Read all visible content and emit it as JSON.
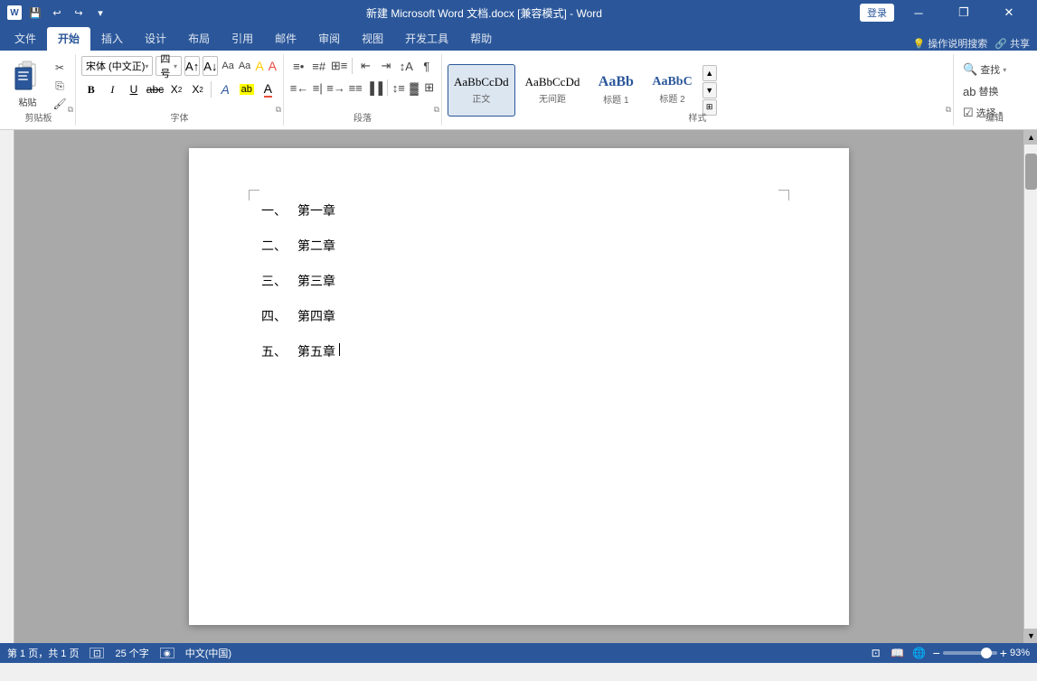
{
  "titlebar": {
    "title": "新建 Microsoft Word 文档.docx [兼容模式] - Word",
    "login_label": "登录",
    "window_buttons": [
      "—",
      "❐",
      "✕"
    ]
  },
  "ribbon_tabs": {
    "items": [
      "文件",
      "开始",
      "插入",
      "设计",
      "布局",
      "引用",
      "邮件",
      "审阅",
      "视图",
      "开发工具",
      "帮助"
    ],
    "active": "开始",
    "right_items": [
      "💡 操作说明搜索",
      "♪ 共享"
    ]
  },
  "toolbar": {
    "clipboard_label": "剪贴板",
    "font_label": "字体",
    "paragraph_label": "段落",
    "styles_label": "样式",
    "editing_label": "编辑",
    "font_name": "宋体 (中文正)",
    "font_size": "四号",
    "styles": [
      {
        "name": "AaBbCcDd",
        "label": "正文",
        "active": true
      },
      {
        "name": "AaBbCcDd",
        "label": "无间距"
      },
      {
        "name": "AaBb",
        "label": "标题 1"
      },
      {
        "name": "AaBbC",
        "label": "标题 2"
      }
    ],
    "editing_buttons": [
      "🔍 查找",
      "ab 替换",
      "☑ 选择"
    ]
  },
  "document": {
    "items": [
      {
        "num": "一、",
        "text": "第一章"
      },
      {
        "num": "二、",
        "text": "第二章"
      },
      {
        "num": "三、",
        "text": "第三章"
      },
      {
        "num": "四、",
        "text": "第四章"
      },
      {
        "num": "五、",
        "text": "第五章"
      }
    ]
  },
  "statusbar": {
    "page_info": "第 1 页，共 1 页",
    "word_count": "25 个字",
    "language": "中文(中国)",
    "zoom": "93%"
  },
  "colors": {
    "ribbon_blue": "#2b579a",
    "accent": "#2b579a"
  }
}
